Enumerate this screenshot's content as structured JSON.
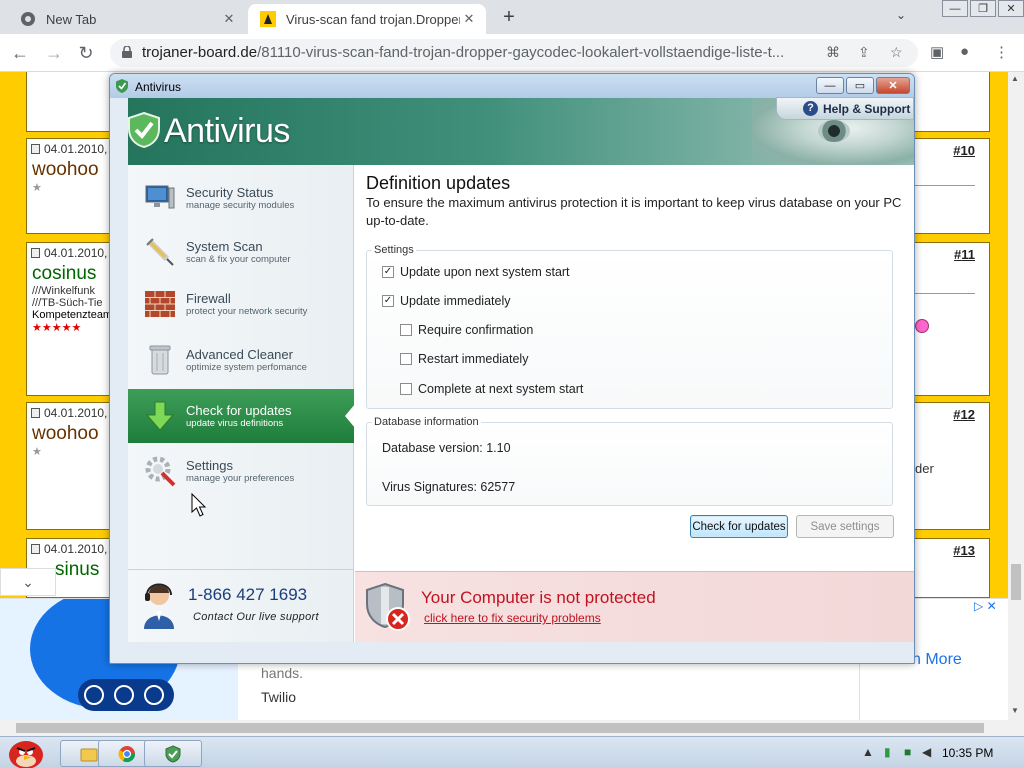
{
  "browser": {
    "tabs": [
      {
        "title": "New Tab",
        "close": "✕"
      },
      {
        "title": "Virus-scan fand trojan.Dropper",
        "close": "✕"
      }
    ],
    "new_tab": "+",
    "tab_search": "⌄",
    "window_buttons": [
      "—",
      "❐",
      "✕"
    ],
    "url_host": "trojaner-board.de",
    "url_path": "/81110-virus-scan-fand-trojan-dropper-gaycodec-lookalert-vollstaendige-liste-t..."
  },
  "forum": {
    "posts": [
      {
        "date": "04.01.2010, 1",
        "user": "woohoo",
        "num": "10"
      },
      {
        "date": "04.01.2010, 1",
        "user": "cosinus",
        "lines": [
          "///Winkelfunk",
          "///TB-Süch-Tie"
        ],
        "badge": "Kompetenzteam",
        "num": "11"
      },
      {
        "date": "04.01.2010, 1",
        "user": "woohoo",
        "num": "12",
        "side": "der"
      },
      {
        "date": "04.01.2010, 1",
        "user": "sinus",
        "num": "13"
      }
    ],
    "hash": "#"
  },
  "ad": {
    "collapse": "⌄",
    "hands": "hands.",
    "brand": "Twilio",
    "more": "n More",
    "adchoice": "▷ ✕"
  },
  "antivirus": {
    "window_title": "Antivirus",
    "logo": "Antivirus",
    "help": "Help & Support",
    "nav": [
      {
        "label": "Security Status",
        "sub": "manage security modules"
      },
      {
        "label": "System Scan",
        "sub": "scan & fix your computer"
      },
      {
        "label": "Firewall",
        "sub": "protect your network security"
      },
      {
        "label": "Advanced Cleaner",
        "sub": "optimize system perfomance"
      },
      {
        "label": "Check for updates",
        "sub": "update virus definitions"
      },
      {
        "label": "Settings",
        "sub": "manage your preferences"
      }
    ],
    "phone": "1-866 427 1693",
    "contact": "Contact Our live support",
    "heading": "Definition updates",
    "description": "To ensure the maximum antivirus protection it is important to keep virus database on your PC up-to-date.",
    "settings_legend": "Settings",
    "options": [
      {
        "label": "Update upon next system start",
        "checked": "✓"
      },
      {
        "label": "Update immediately",
        "checked": "✓"
      },
      {
        "label": "Require confirmation",
        "checked": ""
      },
      {
        "label": "Restart immediately",
        "checked": ""
      },
      {
        "label": "Complete at next system start",
        "checked": ""
      }
    ],
    "db_legend": "Database information",
    "db_version": "Database version: 1.10",
    "signatures": "Virus Signatures: 62577",
    "check_button": "Check for updates",
    "save_button": "Save settings",
    "warning_title": "Your Computer is not protected",
    "warning_link": "click here to fix security problems"
  },
  "taskbar": {
    "clock": "10:35 PM",
    "tray_arrow": "▲"
  }
}
